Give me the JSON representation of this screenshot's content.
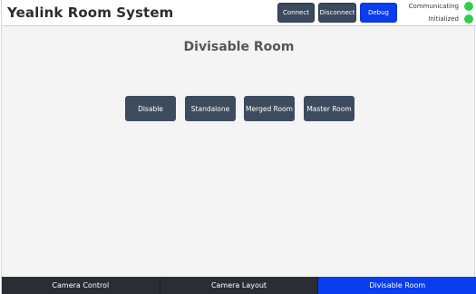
{
  "header": {
    "title": "Yealink Room System",
    "buttons": {
      "connect": "Connect",
      "disconnect": "Disconnect",
      "debug": "Debug"
    },
    "status": [
      {
        "label": "Communicating",
        "color": "#2fcf4a"
      },
      {
        "label": "Initialized",
        "color": "#2fcf4a"
      }
    ]
  },
  "main": {
    "title": "Divisable Room",
    "modes": [
      "Disable",
      "Standalone",
      "Merged Room",
      "Master Room"
    ]
  },
  "footer": {
    "tabs": [
      "Camera Control",
      "Camera Layout",
      "Divisable Room"
    ],
    "active_tab": "Divisable Room"
  },
  "colors": {
    "accent": "#0a3cf0",
    "button": "#3d4b5f",
    "status_ok": "#2fcf4a"
  }
}
